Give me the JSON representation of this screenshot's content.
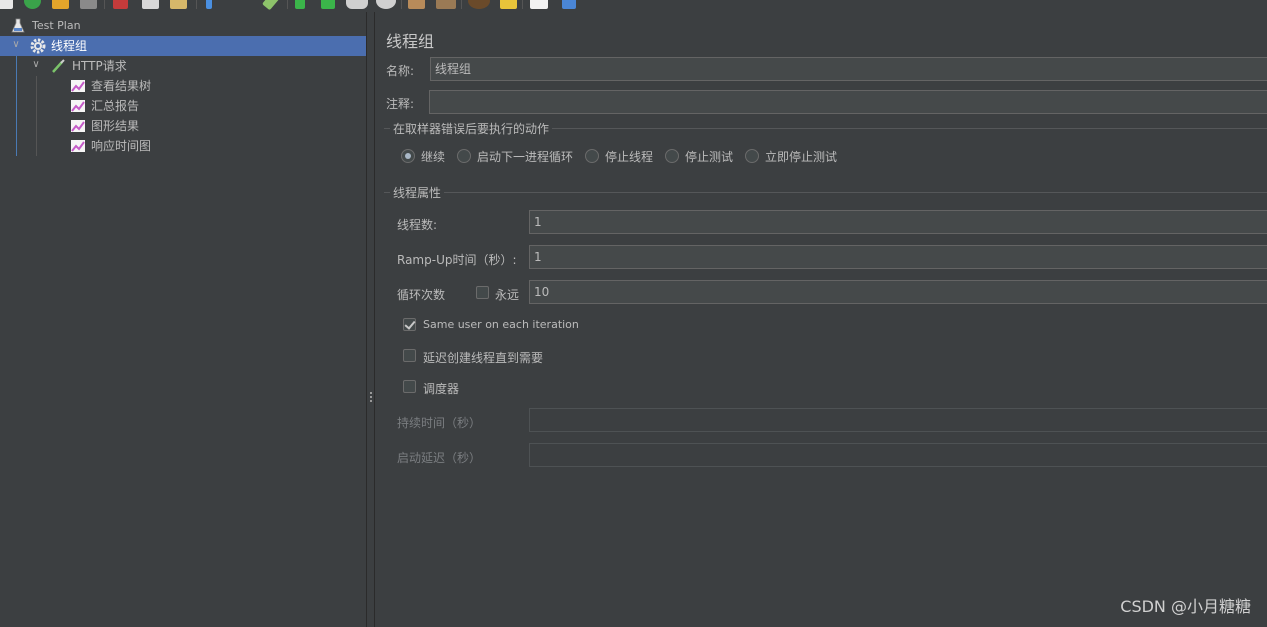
{
  "toolbar": {
    "icons": [
      "new-icon",
      "templates-icon",
      "open-icon",
      "save-icon",
      "cut-icon",
      "copy-icon",
      "paste-icon",
      "expand-icon",
      "toggle-icon",
      "start-icon",
      "start-no-pause-icon",
      "stop-icon",
      "shutdown-icon",
      "clear-icon",
      "clear-all-icon",
      "search-icon",
      "reset-search-icon",
      "function-helper-icon",
      "help-icon"
    ]
  },
  "tree": {
    "test_plan": "Test Plan",
    "thread_group": "线程组",
    "http_request": "HTTP请求",
    "listeners": [
      "查看结果树",
      "汇总报告",
      "图形结果",
      "响应时间图"
    ]
  },
  "main": {
    "title": "线程组",
    "name_label": "名称:",
    "name_value": "线程组",
    "comment_label": "注释:",
    "comment_value": "",
    "error_group_title": "在取样器错误后要执行的动作",
    "error_actions": [
      {
        "label": "继续",
        "checked": true
      },
      {
        "label": "启动下一进程循环",
        "checked": false
      },
      {
        "label": "停止线程",
        "checked": false
      },
      {
        "label": "停止测试",
        "checked": false
      },
      {
        "label": "立即停止测试",
        "checked": false
      }
    ],
    "thread_props_title": "线程属性",
    "threads_label": "线程数:",
    "threads_value": "1",
    "rampup_label": "Ramp-Up时间（秒）:",
    "rampup_value": "1",
    "loop_label": "循环次数",
    "forever_label": "永远",
    "forever_checked": false,
    "loop_value": "10",
    "same_user_label": "Same user on each iteration",
    "same_user_checked": true,
    "delay_create_label": "延迟创建线程直到需要",
    "delay_create_checked": false,
    "scheduler_label": "调度器",
    "scheduler_checked": false,
    "duration_label": "持续时间（秒）",
    "duration_value": "",
    "startup_delay_label": "启动延迟（秒）",
    "startup_delay_value": ""
  },
  "watermark": "CSDN @小月糖糖",
  "colors": {
    "background": "#3c3f41",
    "selection": "#4b6eaf",
    "text": "#bbbbbb",
    "field_bg": "#45494a"
  }
}
